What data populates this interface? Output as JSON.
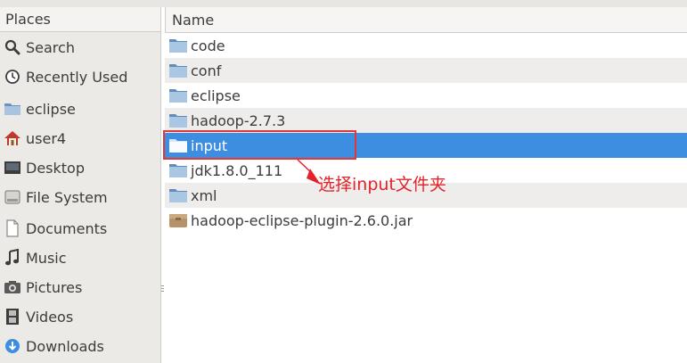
{
  "sidebar": {
    "header": "Places",
    "items": [
      {
        "label": "Search",
        "icon": "search-icon"
      },
      {
        "label": "Recently Used",
        "icon": "clock-icon"
      },
      {
        "label": "eclipse",
        "icon": "folder-icon"
      },
      {
        "label": "user4",
        "icon": "home-icon"
      },
      {
        "label": "Desktop",
        "icon": "desktop-icon"
      },
      {
        "label": "File System",
        "icon": "harddrive-icon"
      },
      {
        "label": "Documents",
        "icon": "document-icon"
      },
      {
        "label": "Music",
        "icon": "music-icon"
      },
      {
        "label": "Pictures",
        "icon": "camera-icon"
      },
      {
        "label": "Videos",
        "icon": "film-icon"
      },
      {
        "label": "Downloads",
        "icon": "download-icon"
      }
    ]
  },
  "file_list": {
    "header": "Name",
    "rows": [
      {
        "name": "code",
        "icon": "folder-icon",
        "selected": false
      },
      {
        "name": "conf",
        "icon": "folder-icon",
        "selected": false
      },
      {
        "name": "eclipse",
        "icon": "folder-icon",
        "selected": false
      },
      {
        "name": "hadoop-2.7.3",
        "icon": "folder-icon",
        "selected": false
      },
      {
        "name": "input",
        "icon": "folder-icon",
        "selected": true
      },
      {
        "name": "jdk1.8.0_111",
        "icon": "folder-icon",
        "selected": false
      },
      {
        "name": "xml",
        "icon": "folder-icon",
        "selected": false
      },
      {
        "name": "hadoop-eclipse-plugin-2.6.0.jar",
        "icon": "package-icon",
        "selected": false
      }
    ]
  },
  "annotation": {
    "text": "选择input文件夹",
    "color": "#e4222a"
  },
  "colors": {
    "selection": "#3d8ee0",
    "sidebar_bg": "#eceae6",
    "stripe": "#eeedeb"
  }
}
